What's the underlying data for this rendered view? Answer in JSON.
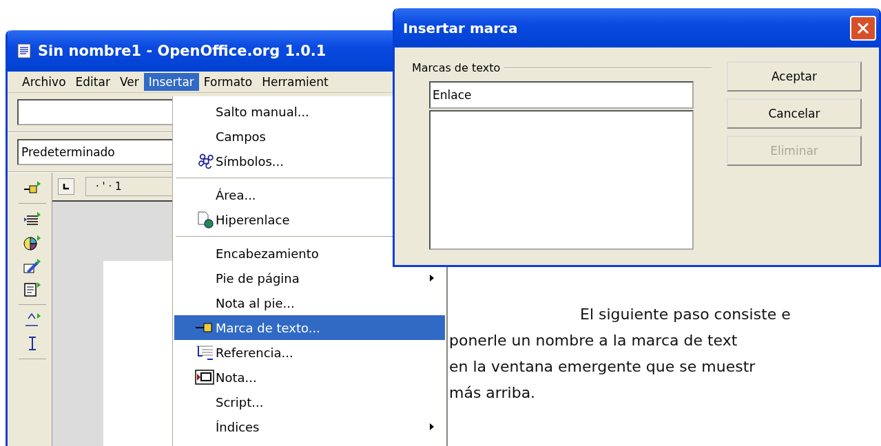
{
  "app_window": {
    "title": "Sin nombre1 - OpenOffice.org 1.0.1",
    "menu_bar": [
      {
        "label": "Archivo",
        "selected": false
      },
      {
        "label": "Editar",
        "selected": false
      },
      {
        "label": "Ver",
        "selected": false
      },
      {
        "label": "Insertar",
        "selected": true
      },
      {
        "label": "Formato",
        "selected": false
      },
      {
        "label": "Herramient",
        "selected": false
      }
    ],
    "style_box": {
      "value": "Predeterminado"
    },
    "ruler": {
      "label": "· ' · 1"
    }
  },
  "insert_menu": {
    "items": [
      {
        "kind": "item",
        "label": "Salto manual...",
        "selected": false
      },
      {
        "kind": "item",
        "label": "Campos",
        "selected": false
      },
      {
        "kind": "item",
        "label": "Símbolos...",
        "selected": false
      },
      {
        "kind": "separator"
      },
      {
        "kind": "item",
        "label": "Área...",
        "selected": false
      },
      {
        "kind": "item",
        "label": "Hiperenlace",
        "selected": false
      },
      {
        "kind": "separator"
      },
      {
        "kind": "item",
        "label": "Encabezamiento",
        "selected": false
      },
      {
        "kind": "item",
        "label": "Pie de página",
        "submenu": true,
        "selected": false
      },
      {
        "kind": "item",
        "label": "Nota al pie...",
        "submenu": false,
        "selected": false
      },
      {
        "kind": "item",
        "label": "Marca de texto...",
        "submenu": false,
        "selected": true
      },
      {
        "kind": "item",
        "label": "Referencia...",
        "submenu": false,
        "selected": false
      },
      {
        "kind": "item",
        "label": "Nota...",
        "submenu": false,
        "selected": false
      },
      {
        "kind": "item",
        "label": "Script...",
        "submenu": false,
        "selected": false
      },
      {
        "kind": "item",
        "label": "Índices",
        "submenu": true,
        "selected": false
      }
    ]
  },
  "dialog": {
    "title": "Insertar marca",
    "group_label": "Marcas de texto",
    "name_field": {
      "value": "Enlace"
    },
    "buttons": [
      {
        "label": "Aceptar",
        "disabled": false
      },
      {
        "label": "Cancelar",
        "disabled": false
      },
      {
        "label": "Eliminar",
        "disabled": true
      }
    ]
  },
  "paragraph_lines": [
    "El siguiente paso consiste e",
    "ponerle un nombre a la marca de text",
    "en la ventana emergente que se muestr",
    "más arriba."
  ]
}
